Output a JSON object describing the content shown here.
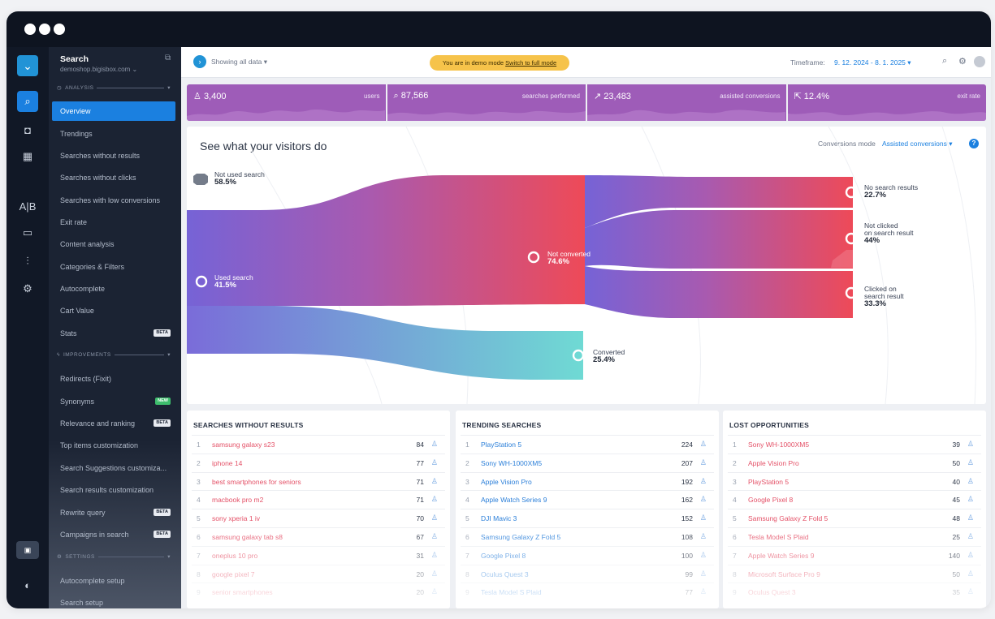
{
  "sidebar": {
    "title": "Search",
    "subtitle": "demoshop.bigisbox.com ⌄",
    "analysis_label": "ANALYSIS",
    "improvements_label": "IMPROVEMENTS",
    "settings_label": "SETTINGS",
    "items": [
      {
        "label": "Overview"
      },
      {
        "label": "Trendings"
      },
      {
        "label": "Searches without results"
      },
      {
        "label": "Searches without clicks"
      },
      {
        "label": "Searches with low conversions"
      },
      {
        "label": "Exit rate"
      },
      {
        "label": "Content analysis"
      },
      {
        "label": "Categories & Filters"
      },
      {
        "label": "Autocomplete"
      },
      {
        "label": "Cart Value"
      },
      {
        "label": "Stats",
        "badge": "BETA"
      }
    ],
    "improvements": [
      {
        "label": "Redirects (Fixit)"
      },
      {
        "label": "Synonyms",
        "badge": "NEW"
      },
      {
        "label": "Relevance and ranking",
        "badge": "BETA"
      },
      {
        "label": "Top items customization"
      },
      {
        "label": "Search Suggestions customiza..."
      },
      {
        "label": "Search results customization"
      },
      {
        "label": "Rewrite query",
        "badge": "BETA"
      },
      {
        "label": "Campaigns in search",
        "badge": "BETA"
      }
    ],
    "settings": [
      {
        "label": "Autocomplete setup"
      },
      {
        "label": "Search setup"
      }
    ]
  },
  "topbar": {
    "showing": "Showing all data ▾",
    "demo_text": "You are in demo mode",
    "demo_link": "Switch to full mode",
    "timeframe_label": "Timeframe:",
    "timeframe_value": "9. 12. 2024 - 8. 1. 2025 ▾"
  },
  "metrics": [
    {
      "value": "3,400",
      "label": "users",
      "icon": "user-icon"
    },
    {
      "value": "87,566",
      "label": "searches performed",
      "icon": "search-icon"
    },
    {
      "value": "23,483",
      "label": "assisted conversions",
      "icon": "trend-icon"
    },
    {
      "value": "12.4%",
      "label": "exit rate",
      "icon": "exit-icon"
    }
  ],
  "flow": {
    "title": "See what your visitors do",
    "conversions_mode_label": "Conversions mode",
    "conversions_mode_value": "Assisted conversions ▾",
    "help": "?",
    "nodes": {
      "not_used": {
        "label": "Not used search",
        "value": "58.5%"
      },
      "used": {
        "label": "Used search",
        "value": "41.5%"
      },
      "not_converted": {
        "label": "Not converted",
        "value": "74.6%"
      },
      "converted": {
        "label": "Converted",
        "value": "25.4%"
      },
      "no_results": {
        "label": "No search results",
        "value": "22.7%"
      },
      "not_clicked_1": "Not clicked",
      "not_clicked_2": "on search result",
      "not_clicked_value": "44%",
      "clicked_1": "Clicked on",
      "clicked_2": "search result",
      "clicked_value": "33.3%"
    }
  },
  "colors": {
    "accent": "#1b80e0",
    "purple": "#9e5cb8",
    "red": "#e45268",
    "teal": "#6fdad4"
  },
  "tables": {
    "without_results": {
      "title": "SEARCHES WITHOUT RESULTS",
      "rows": [
        {
          "rank": "1",
          "text": "samsung galaxy s23",
          "count": "84"
        },
        {
          "rank": "2",
          "text": "iphone 14",
          "count": "77"
        },
        {
          "rank": "3",
          "text": "best smartphones for seniors",
          "count": "71"
        },
        {
          "rank": "4",
          "text": "macbook pro m2",
          "count": "71"
        },
        {
          "rank": "5",
          "text": "sony xperia 1 iv",
          "count": "70"
        },
        {
          "rank": "6",
          "text": "samsung galaxy tab s8",
          "count": "67"
        },
        {
          "rank": "7",
          "text": "oneplus 10 pro",
          "count": "31"
        },
        {
          "rank": "8",
          "text": "google pixel 7",
          "count": "20"
        },
        {
          "rank": "9",
          "text": "senior smartphones",
          "count": "20"
        }
      ]
    },
    "trending": {
      "title": "TRENDING SEARCHES",
      "rows": [
        {
          "rank": "1",
          "text": "PlayStation 5",
          "count": "224"
        },
        {
          "rank": "2",
          "text": "Sony WH-1000XM5",
          "count": "207"
        },
        {
          "rank": "3",
          "text": "Apple Vision Pro",
          "count": "192"
        },
        {
          "rank": "4",
          "text": "Apple Watch Series 9",
          "count": "162"
        },
        {
          "rank": "5",
          "text": "DJI Mavic 3",
          "count": "152"
        },
        {
          "rank": "6",
          "text": "Samsung Galaxy Z Fold 5",
          "count": "108"
        },
        {
          "rank": "7",
          "text": "Google Pixel 8",
          "count": "100"
        },
        {
          "rank": "8",
          "text": "Oculus Quest 3",
          "count": "99"
        },
        {
          "rank": "9",
          "text": "Tesla Model S Plaid",
          "count": "77"
        }
      ]
    },
    "lost": {
      "title": "LOST OPPORTUNITIES",
      "rows": [
        {
          "rank": "1",
          "text": "Sony WH-1000XM5",
          "count": "39"
        },
        {
          "rank": "2",
          "text": "Apple Vision Pro",
          "count": "50"
        },
        {
          "rank": "3",
          "text": "PlayStation 5",
          "count": "40"
        },
        {
          "rank": "4",
          "text": "Google Pixel 8",
          "count": "45"
        },
        {
          "rank": "5",
          "text": "Samsung Galaxy Z Fold 5",
          "count": "48"
        },
        {
          "rank": "6",
          "text": "Tesla Model S Plaid",
          "count": "25"
        },
        {
          "rank": "7",
          "text": "Apple Watch Series 9",
          "count": "140"
        },
        {
          "rank": "8",
          "text": "Microsoft Surface Pro 9",
          "count": "50"
        },
        {
          "rank": "9",
          "text": "Oculus Quest 3",
          "count": "35"
        }
      ]
    }
  }
}
